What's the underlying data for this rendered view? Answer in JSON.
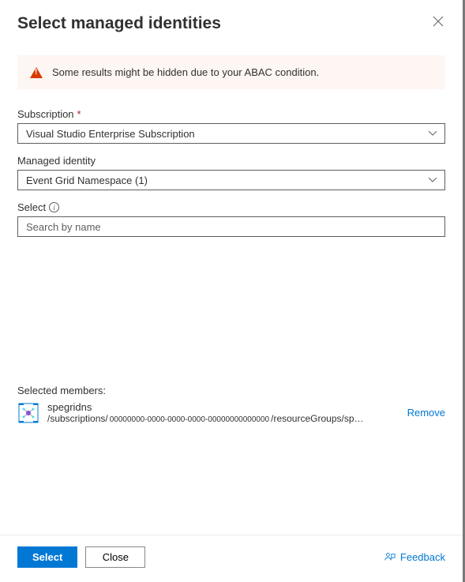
{
  "header": {
    "title": "Select managed identities"
  },
  "alert": {
    "message": "Some results might be hidden due to your ABAC condition."
  },
  "fields": {
    "subscription": {
      "label": "Subscription",
      "value": "Visual Studio Enterprise Subscription"
    },
    "managed_identity": {
      "label": "Managed identity",
      "value": "Event Grid Namespace (1)"
    },
    "select": {
      "label": "Select",
      "placeholder": "Search by name"
    }
  },
  "selected": {
    "label": "Selected members:",
    "member": {
      "name": "spegridns",
      "path_prefix": "/subscriptions/",
      "guid": "00000000-0000-0000-0000-00000000000000",
      "path_suffix": "/resourceGroups/sp…",
      "remove_label": "Remove"
    }
  },
  "footer": {
    "select_label": "Select",
    "close_label": "Close",
    "feedback_label": "Feedback"
  }
}
